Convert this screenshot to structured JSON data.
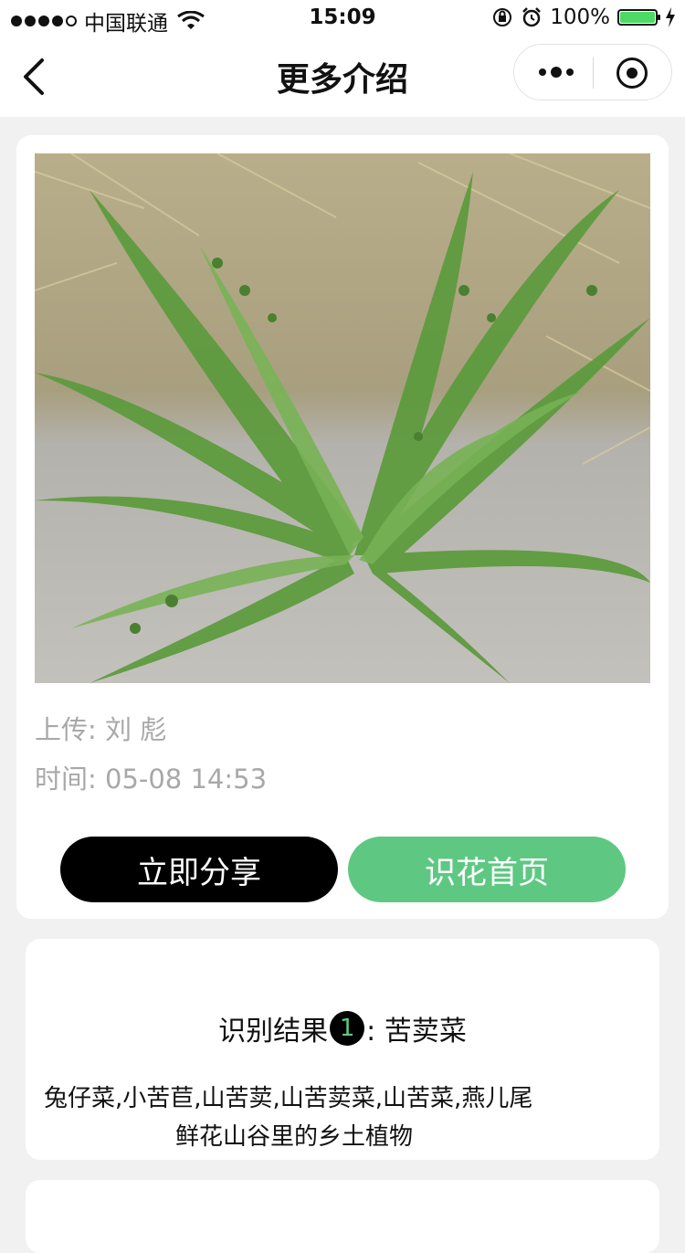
{
  "status_bar": {
    "carrier": "中国联通",
    "time": "15:09",
    "battery": "100%"
  },
  "nav": {
    "title": "更多介绍"
  },
  "upload": {
    "uploader": "上传: 刘 彪",
    "time": "时间: 05-08 14:53"
  },
  "buttons": {
    "share": "立即分享",
    "home": "识花首页"
  },
  "result": {
    "label": "识别结果",
    "index": "1",
    "name": ":  苦荬菜",
    "aliases": "兔仔菜,小苦苣,山苦荬,山苦荬菜,山苦菜,燕儿尾",
    "description": "鲜花山谷里的乡土植物"
  },
  "colors": {
    "accent_green": "#5ec882",
    "battery_green": "#4cd964"
  }
}
